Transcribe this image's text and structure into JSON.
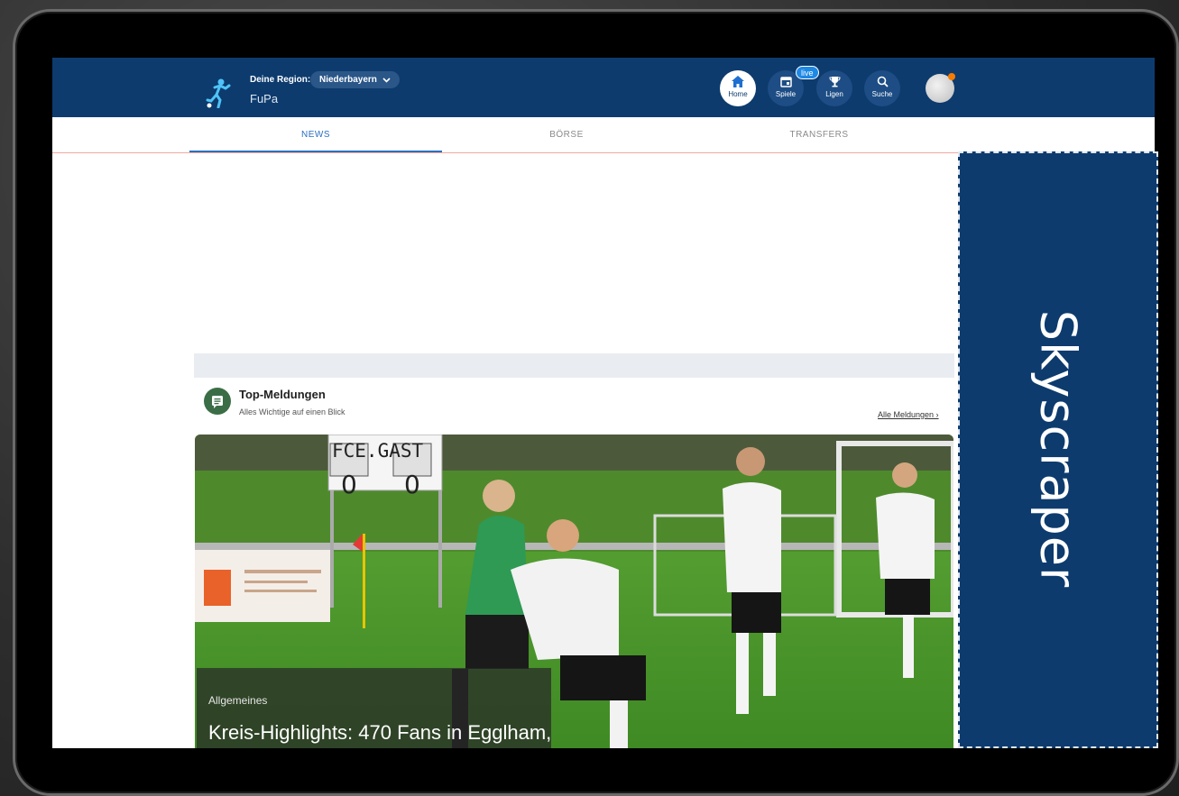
{
  "header": {
    "region_label": "Deine Region:",
    "region_value": "Niederbayern",
    "region_chevron": "⌄",
    "brand": "FuPa",
    "live_badge": "live",
    "nav": [
      {
        "label": "Home",
        "icon": "home-icon",
        "active": true
      },
      {
        "label": "Spiele",
        "icon": "calendar-icon",
        "active": false
      },
      {
        "label": "Ligen",
        "icon": "trophy-icon",
        "active": false
      },
      {
        "label": "Suche",
        "icon": "search-icon",
        "active": false
      }
    ]
  },
  "tabs": [
    {
      "label": "NEWS",
      "active": true
    },
    {
      "label": "BÖRSE",
      "active": false
    },
    {
      "label": "TRANSFERS",
      "active": false
    }
  ],
  "section": {
    "title": "Top-Meldungen",
    "subtitle": "Alles Wichtige auf einen Blick",
    "link": "Alle Meldungen ›"
  },
  "article": {
    "category": "Allgemeines",
    "title": "Kreis-Highlights: 470 Fans in Egglham,",
    "scoreboard": {
      "teams": "FCE.GAST",
      "home": "0",
      "away": "0"
    }
  },
  "ad": {
    "label": "Skyscraper"
  },
  "colors": {
    "primary": "#0d3b6e",
    "accent": "#2b6fc2",
    "live": "#1e88e5",
    "news_icon": "#3b6e47"
  }
}
